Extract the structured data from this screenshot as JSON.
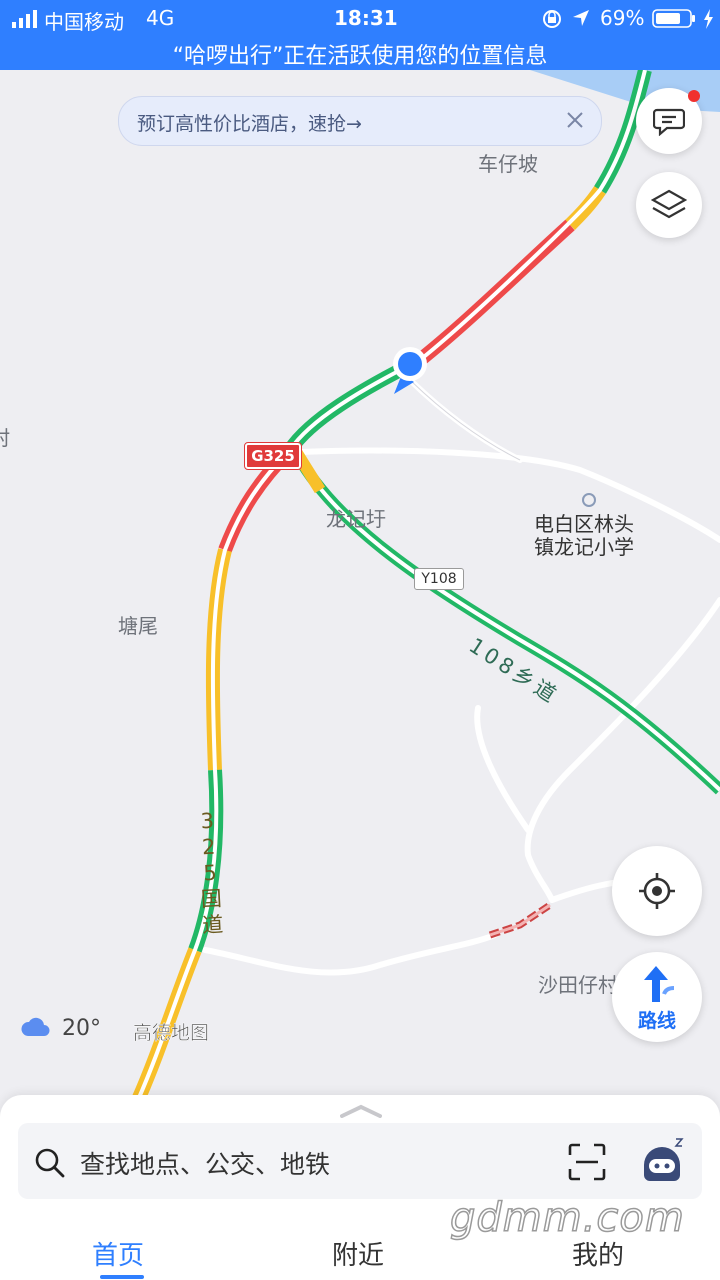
{
  "status_bar": {
    "carrier": "中国移动",
    "network": "4G",
    "time": "18:31",
    "battery": "69%",
    "location_notice": "“哈啰出行”正在活跃使用您的位置信息"
  },
  "promo_banner": {
    "text": "预订高性价比酒店，速抢→"
  },
  "map": {
    "place_labels": {
      "chezaipo": "车仔坡",
      "cun_partial": "村",
      "longjixu": "龙记圩",
      "school_line1": "电白区林头",
      "school_line2": "镇龙记小学",
      "tangwei": "塘尾",
      "shatianzai": "沙田仔村"
    },
    "road_labels": {
      "g325_shield": "G325",
      "y108_shield": "Y108",
      "xiangdao_108": "108乡道",
      "guodao_325": "325国道"
    },
    "weather": {
      "temperature": "20°"
    },
    "attribution": "高德地图"
  },
  "buttons": {
    "route_label": "路线"
  },
  "search": {
    "placeholder": "查找地点、公交、地铁"
  },
  "tabs": [
    {
      "label": "首页",
      "active": true
    },
    {
      "label": "附近",
      "active": false
    },
    {
      "label": "我的",
      "active": false
    }
  ],
  "watermark": "gdmm.com",
  "colors": {
    "status_bar": "#2f7fff",
    "traffic_green": "#22b866",
    "traffic_yellow": "#f8c02a",
    "traffic_red": "#ee4a4a",
    "accent": "#2f7fff"
  }
}
